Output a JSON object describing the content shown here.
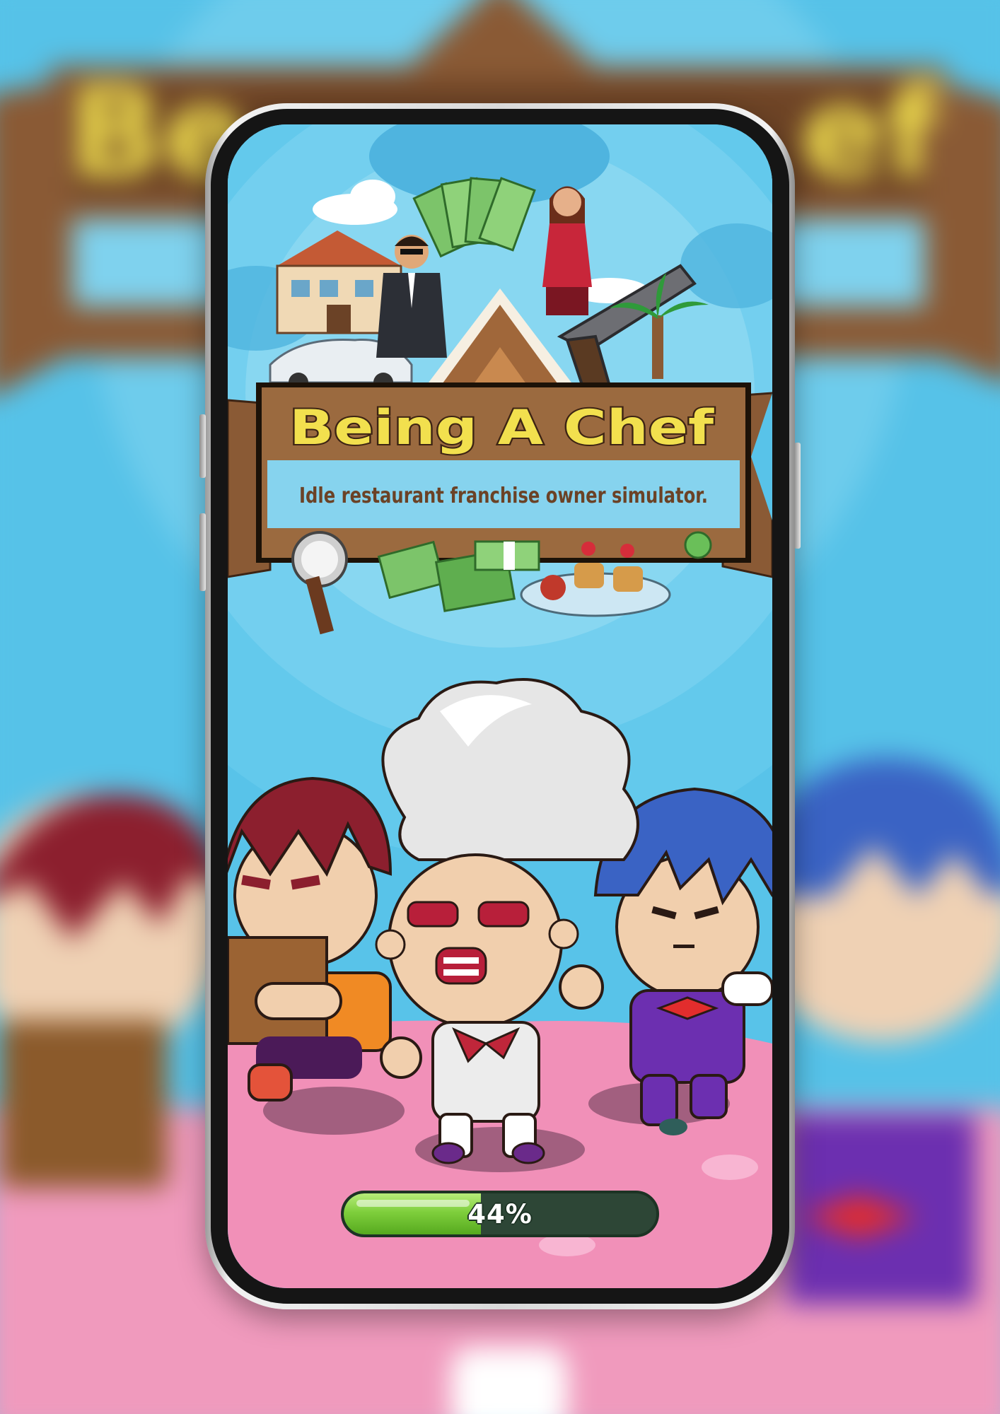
{
  "game": {
    "title": "Being A Chef",
    "subtitle": "Idle restaurant franchise owner simulator."
  },
  "loading": {
    "progress": 0.44,
    "label": "44%"
  },
  "colors": {
    "sky": "#58c3e9",
    "title_yellow": "#f2e04e",
    "banner_brown": "#8a5a35",
    "floor_pink": "#f08fb6",
    "bar_green": "#7fcf3c",
    "bar_track": "#2d4636"
  },
  "characters": [
    {
      "role": "chef",
      "icon": "chef-character"
    },
    {
      "role": "red-haired-worker",
      "icon": "delivery-character"
    },
    {
      "role": "blue-haired-waiter",
      "icon": "waiter-character"
    }
  ]
}
